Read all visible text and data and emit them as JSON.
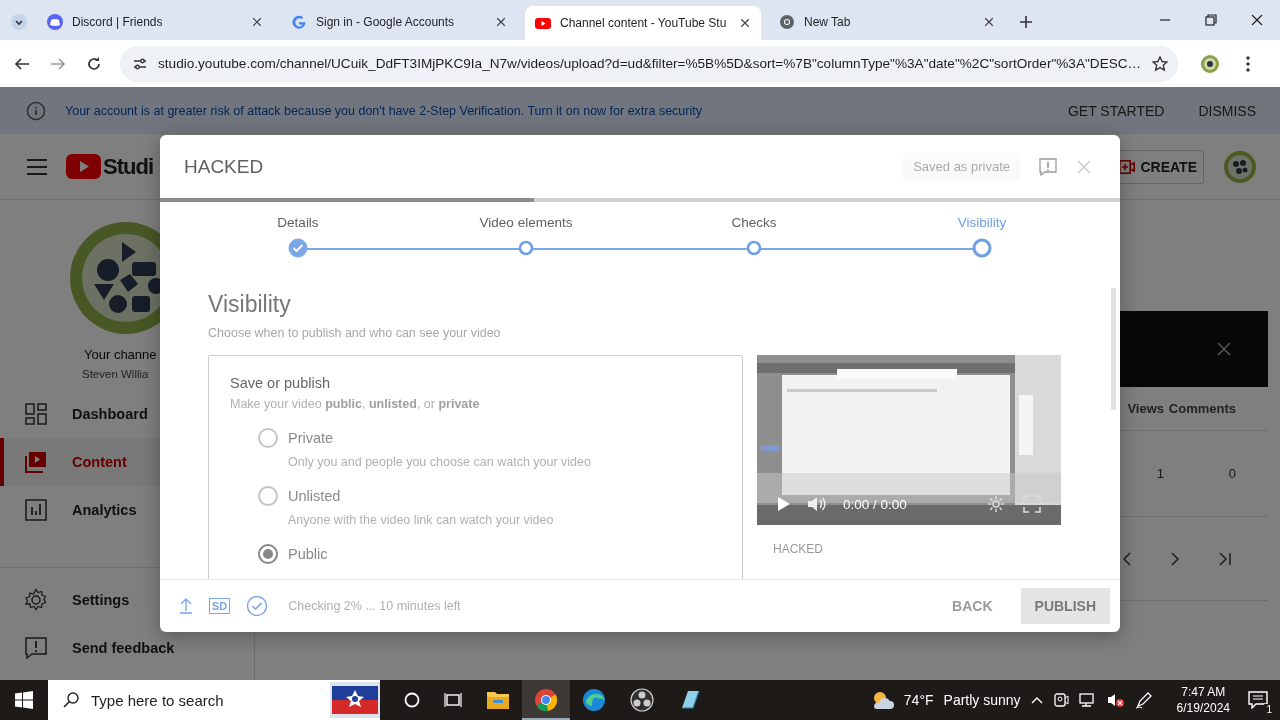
{
  "browser": {
    "tabs": [
      {
        "title": "Discord | Friends",
        "selected": false
      },
      {
        "title": "Sign in - Google Accounts",
        "selected": false
      },
      {
        "title": "Channel content - YouTube Stu",
        "selected": true
      },
      {
        "title": "New Tab",
        "selected": false
      }
    ],
    "url": "studio.youtube.com/channel/UCuik_DdFT3IMjPKC9Ia_N7w/videos/upload?d=ud&filter=%5B%5D&sort=%7B\"columnType\"%3A\"date\"%2C\"sortOrder\"%3A\"DESC…"
  },
  "banner": {
    "message": "Your account is at greater risk of attack because you don't have 2-Step Verification. Turn it on now for extra security",
    "actions": [
      "GET STARTED",
      "DISMISS"
    ]
  },
  "studio": {
    "logo": "Studi",
    "create": "CREATE",
    "channel_title": "Your channe",
    "channel_name": "Steven Willia",
    "nav": [
      {
        "label": "Dashboard",
        "selected": false
      },
      {
        "label": "Content",
        "selected": true
      },
      {
        "label": "Analytics",
        "selected": false
      }
    ],
    "footer_nav": [
      {
        "label": "Settings"
      },
      {
        "label": "Send feedback"
      }
    ],
    "table": {
      "columns": [
        "Views",
        "Comments"
      ],
      "rows": [
        [
          "1",
          "0"
        ]
      ]
    }
  },
  "dialog": {
    "title": "HACKED",
    "save_status": "Saved as private",
    "progress": {
      "level": 0.39
    },
    "steps": [
      {
        "label": "Details",
        "done": true,
        "selected": false
      },
      {
        "label": "Video elements",
        "done": false,
        "selected": false
      },
      {
        "label": "Checks",
        "done": false,
        "selected": false
      },
      {
        "label": "Visibility",
        "done": false,
        "selected": true
      }
    ],
    "heading": "Visibility",
    "subheading": "Choose when to publish and who can see your video",
    "card": {
      "title": "Save or publish",
      "hint": "Make your video **public**, **unlisted**, or **private**",
      "options": [
        {
          "label": "Private",
          "description": "Only you and people you choose can watch your video",
          "selected": false
        },
        {
          "label": "Unlisted",
          "description": "Anyone with the video link can watch your video",
          "selected": false
        },
        {
          "label": "Public",
          "selected": true
        }
      ]
    },
    "video": {
      "kind": "picture",
      "time": "0:00 / 0:00",
      "title": "HACKED"
    },
    "footer": {
      "quality": "SD",
      "status": "Checking 2% ... 10 minutes left",
      "buttons": [
        {
          "label": "BACK",
          "disabled": true
        },
        {
          "label": "PUBLISH",
          "disabled": true
        }
      ]
    }
  },
  "taskbar": {
    "search_placeholder": "Type here to search",
    "weather": {
      "temp": "74°F",
      "text": "Partly sunny"
    },
    "time": "7:47 AM",
    "date": "6/19/2024",
    "notifications": "1"
  }
}
